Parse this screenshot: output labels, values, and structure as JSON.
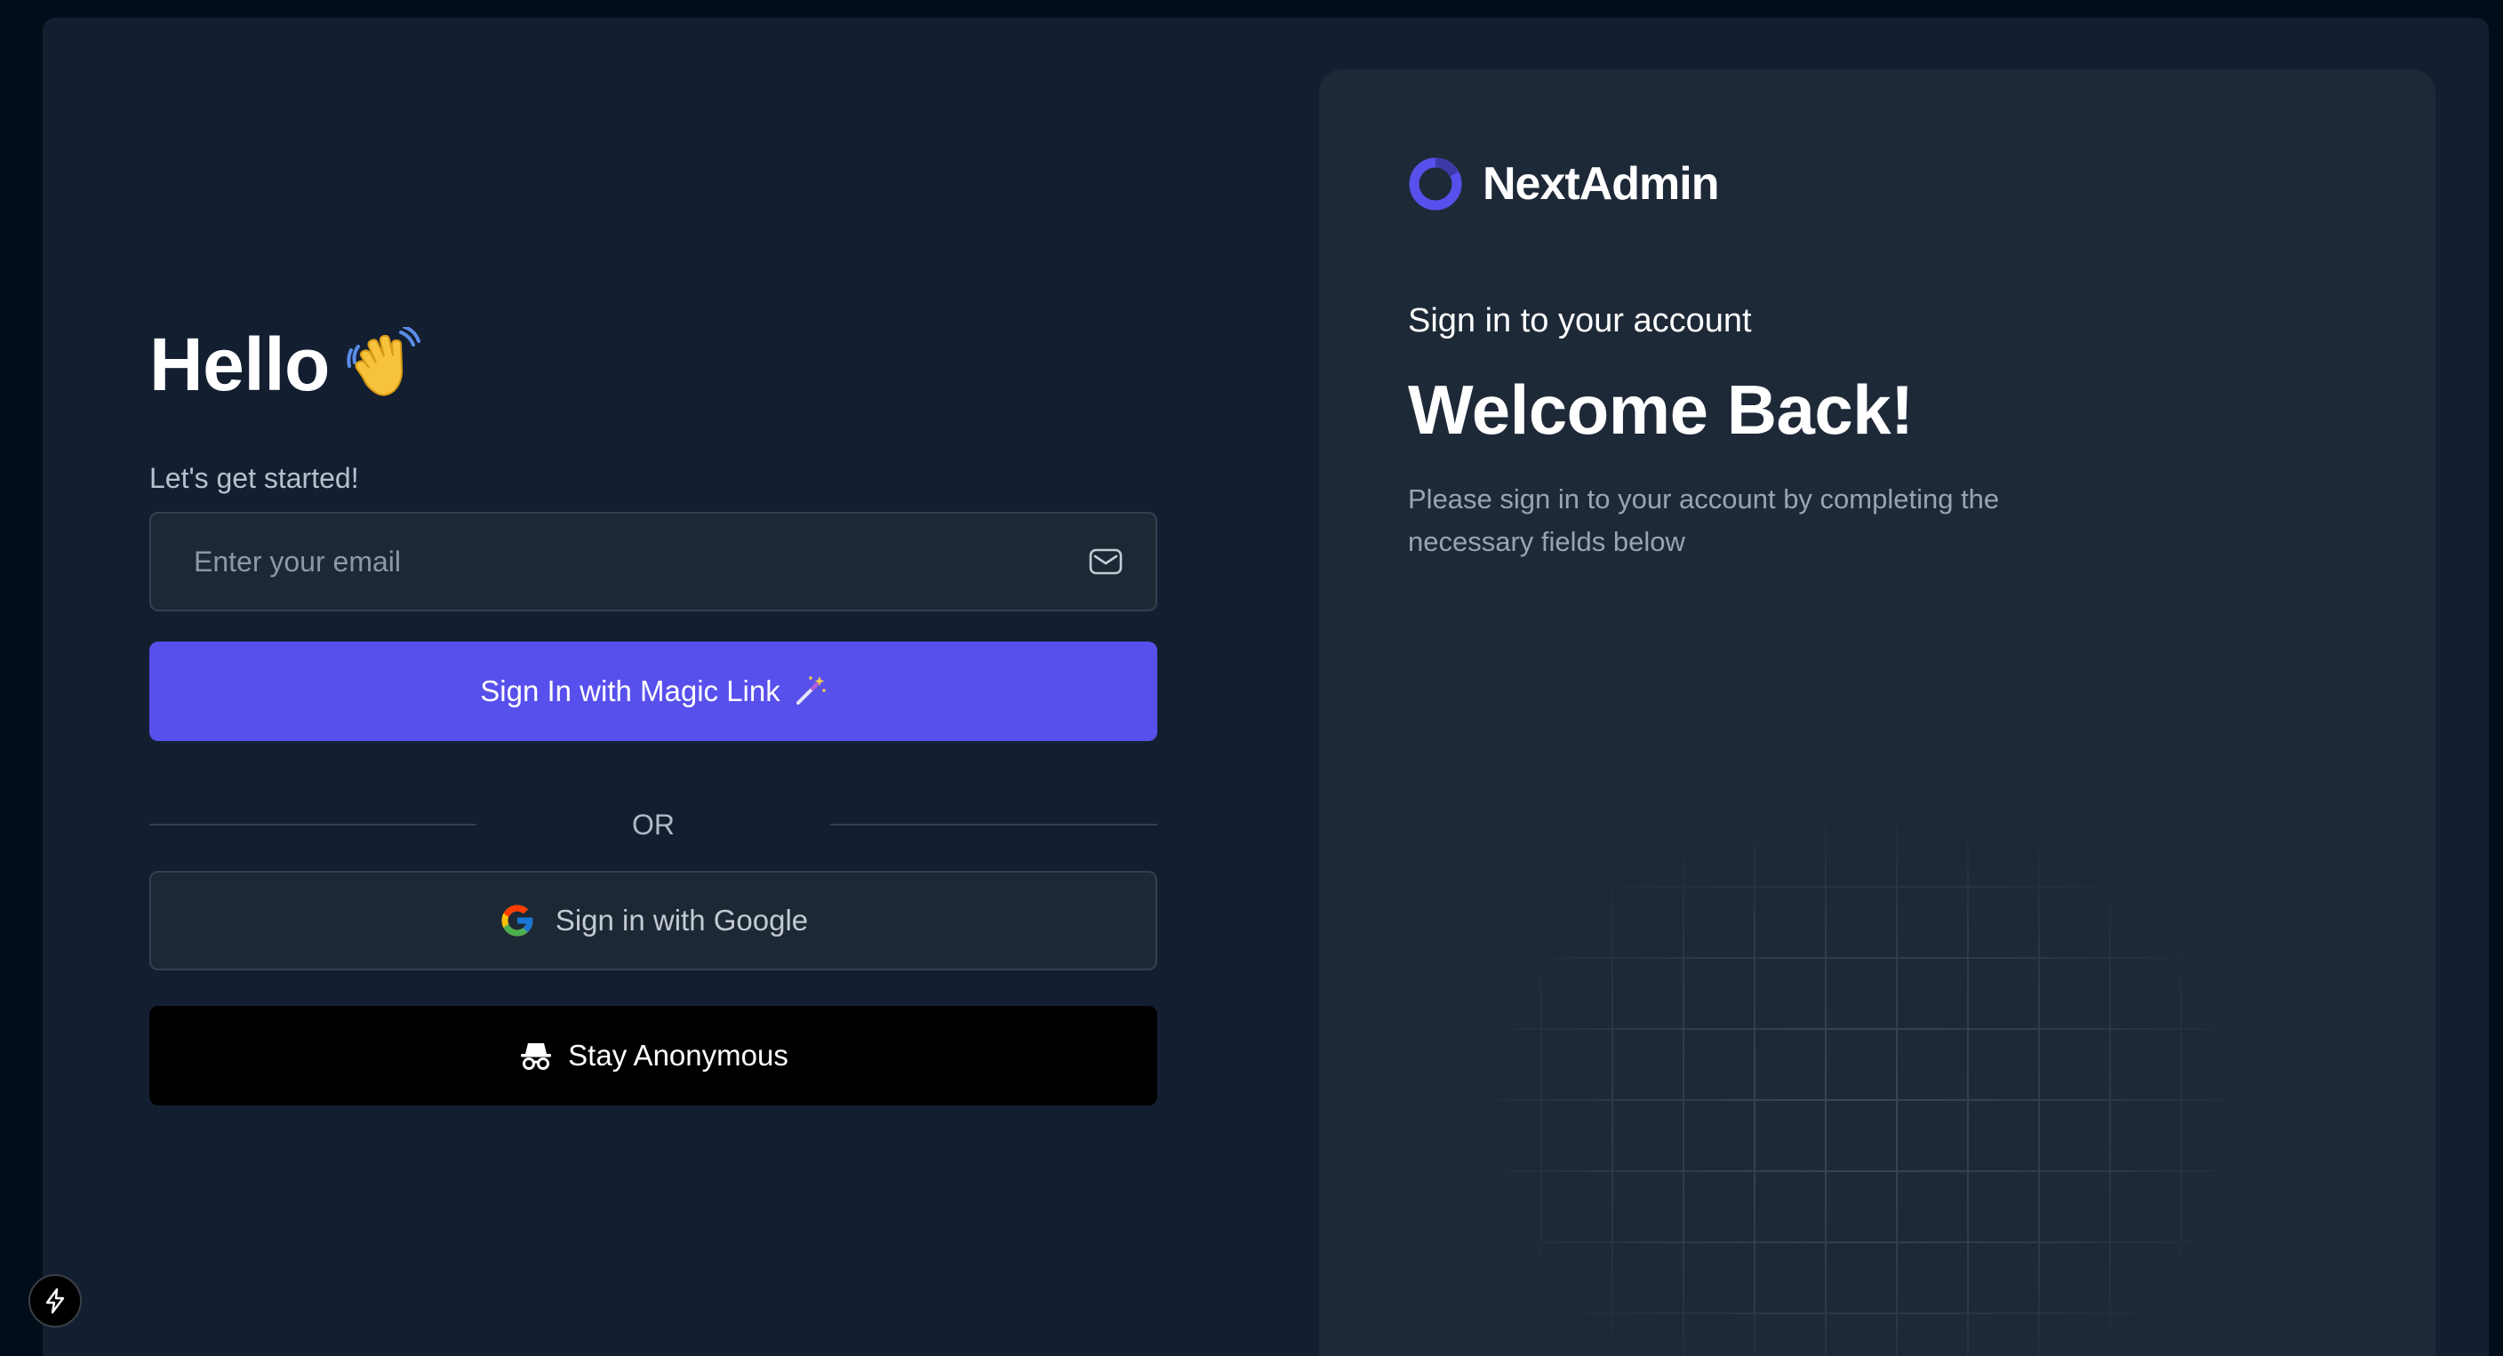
{
  "left": {
    "greeting": "Hello",
    "greeting_icon": "waving-hand-icon",
    "subtitle": "Let's get started!",
    "email": {
      "placeholder": "Enter your email",
      "value": "",
      "icon": "mail-icon"
    },
    "magic_link_button": {
      "label": "Sign In with Magic Link",
      "icon": "magic-wand-icon",
      "color": "#5850ec"
    },
    "divider_text": "OR",
    "google_button": {
      "label": "Sign in with Google",
      "icon": "google-icon"
    },
    "anonymous_button": {
      "label": "Stay Anonymous",
      "icon": "incognito-icon",
      "color": "#000000"
    }
  },
  "panel": {
    "brand": "NextAdmin",
    "brand_color": "#5850ec",
    "kicker": "Sign in to your account",
    "title": "Welcome Back!",
    "description": "Please sign in to your account by completing the necessary fields below"
  },
  "dev_badge": {
    "icon": "lightning-bolt-icon"
  }
}
